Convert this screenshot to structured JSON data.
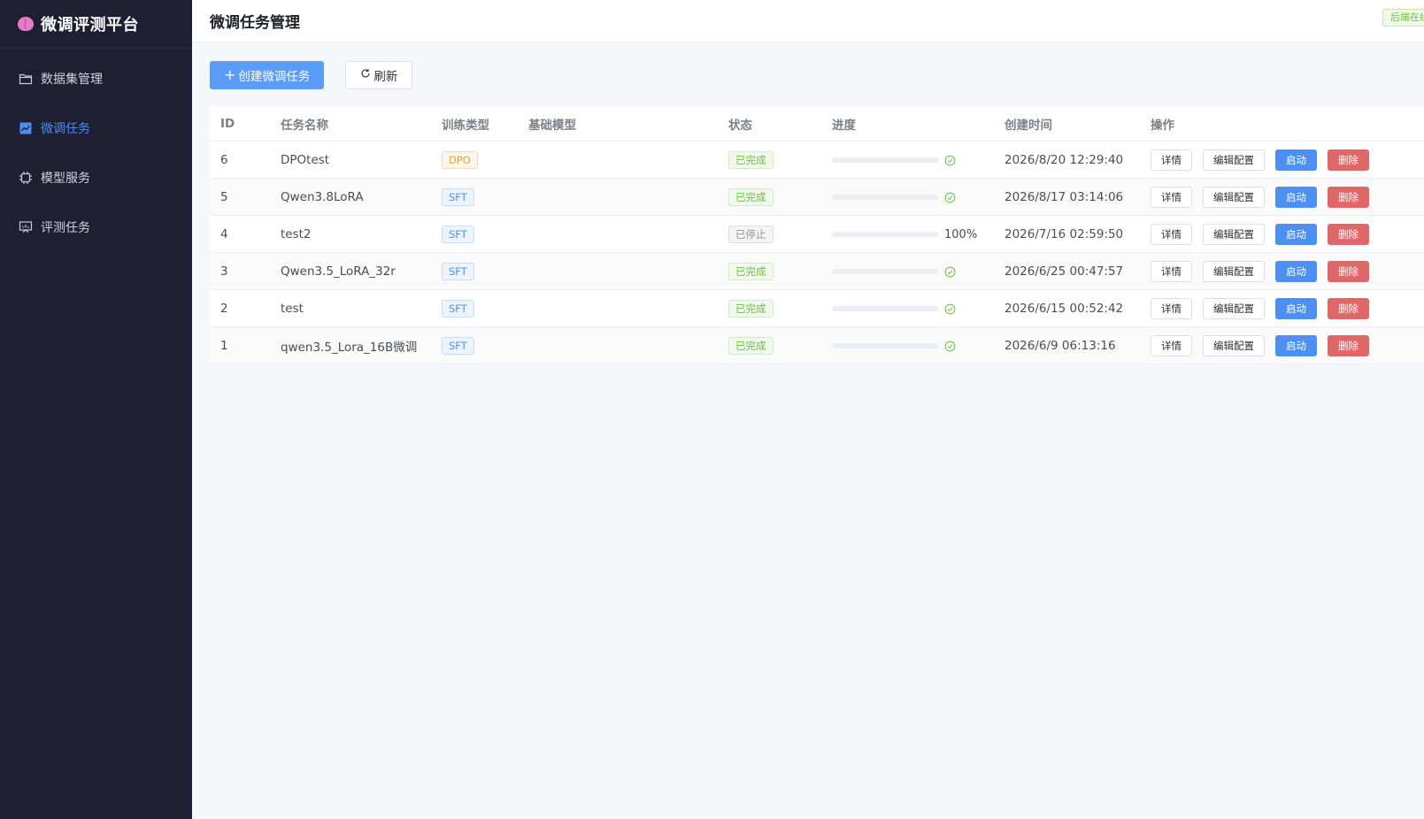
{
  "brand": {
    "title": "微调评测平台",
    "icon": "brain-icon"
  },
  "sidebar": {
    "items": [
      {
        "label": "数据集管理",
        "icon": "folder-icon",
        "active": false
      },
      {
        "label": "微调任务",
        "icon": "chart-icon",
        "active": true
      },
      {
        "label": "模型服务",
        "icon": "chip-icon",
        "active": false
      },
      {
        "label": "评测任务",
        "icon": "presentation-icon",
        "active": false
      }
    ]
  },
  "header": {
    "title": "微调任务管理",
    "badge": "后端在线"
  },
  "toolbar": {
    "create_label": "创建微调任务",
    "refresh_label": "刷新"
  },
  "table": {
    "columns": {
      "id": "ID",
      "name": "任务名称",
      "type": "训练类型",
      "model": "基础模型",
      "status": "状态",
      "progress": "进度",
      "created": "创建时间",
      "ops": "操作"
    },
    "op_labels": {
      "detail": "详情",
      "edit": "编辑配置",
      "start": "启动",
      "delete": "删除"
    },
    "rows": [
      {
        "id": "6",
        "name": "DPOtest",
        "type": "DPO",
        "model": "",
        "status": "已完成",
        "progress": 100,
        "progress_text": "",
        "created": "2026/8/20 12:29:40"
      },
      {
        "id": "5",
        "name": "Qwen3.8LoRA",
        "type": "SFT",
        "model": "",
        "status": "已完成",
        "progress": 100,
        "progress_text": "",
        "created": "2026/8/17 03:14:06"
      },
      {
        "id": "4",
        "name": "test2",
        "type": "SFT",
        "model": "",
        "status": "已停止",
        "progress": 100,
        "progress_text": "100%",
        "created": "2026/7/16 02:59:50"
      },
      {
        "id": "3",
        "name": "Qwen3.5_LoRA_32r",
        "type": "SFT",
        "model": "",
        "status": "已完成",
        "progress": 100,
        "progress_text": "",
        "created": "2026/6/25 00:47:57"
      },
      {
        "id": "2",
        "name": "test",
        "type": "SFT",
        "model": "",
        "status": "已完成",
        "progress": 100,
        "progress_text": "",
        "created": "2026/6/15 00:52:42"
      },
      {
        "id": "1",
        "name": "qwen3.5_Lora_16B微调",
        "type": "SFT",
        "model": "",
        "status": "已完成",
        "progress": 100,
        "progress_text": "",
        "created": "2026/6/9 06:13:16"
      }
    ]
  },
  "colors": {
    "sidebar_bg": "#1f1f33",
    "accent": "#4e8ff2",
    "success": "#67c23a",
    "danger": "#e06767",
    "warning": "#e6a23c"
  }
}
